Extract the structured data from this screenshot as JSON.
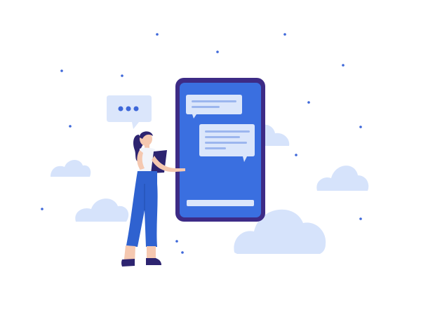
{
  "colors": {
    "background": "#ffffff",
    "cloud": "#d6e3fb",
    "cloud_dark": "#c8d8f8",
    "phone_frame": "#3d2b86",
    "phone_screen": "#3a6fe0",
    "chat_bubble": "#dbe6fb",
    "chat_line": "#9cb6ee",
    "dot": "#3d67d9",
    "skin": "#f5c8b0",
    "hair": "#2d2470",
    "pants": "#2f62d0",
    "shirt": "#f2f4fa",
    "tablet": "#2d2470",
    "shoes": "#2d2470"
  },
  "icons": {
    "thought_bubble": "speech-bubble-ellipsis-icon",
    "phone": "smartphone-icon",
    "message_incoming": "chat-message-icon",
    "message_outgoing": "chat-message-icon"
  },
  "illustration": {
    "subject": "woman-with-tablet",
    "device": "smartphone-chat"
  }
}
